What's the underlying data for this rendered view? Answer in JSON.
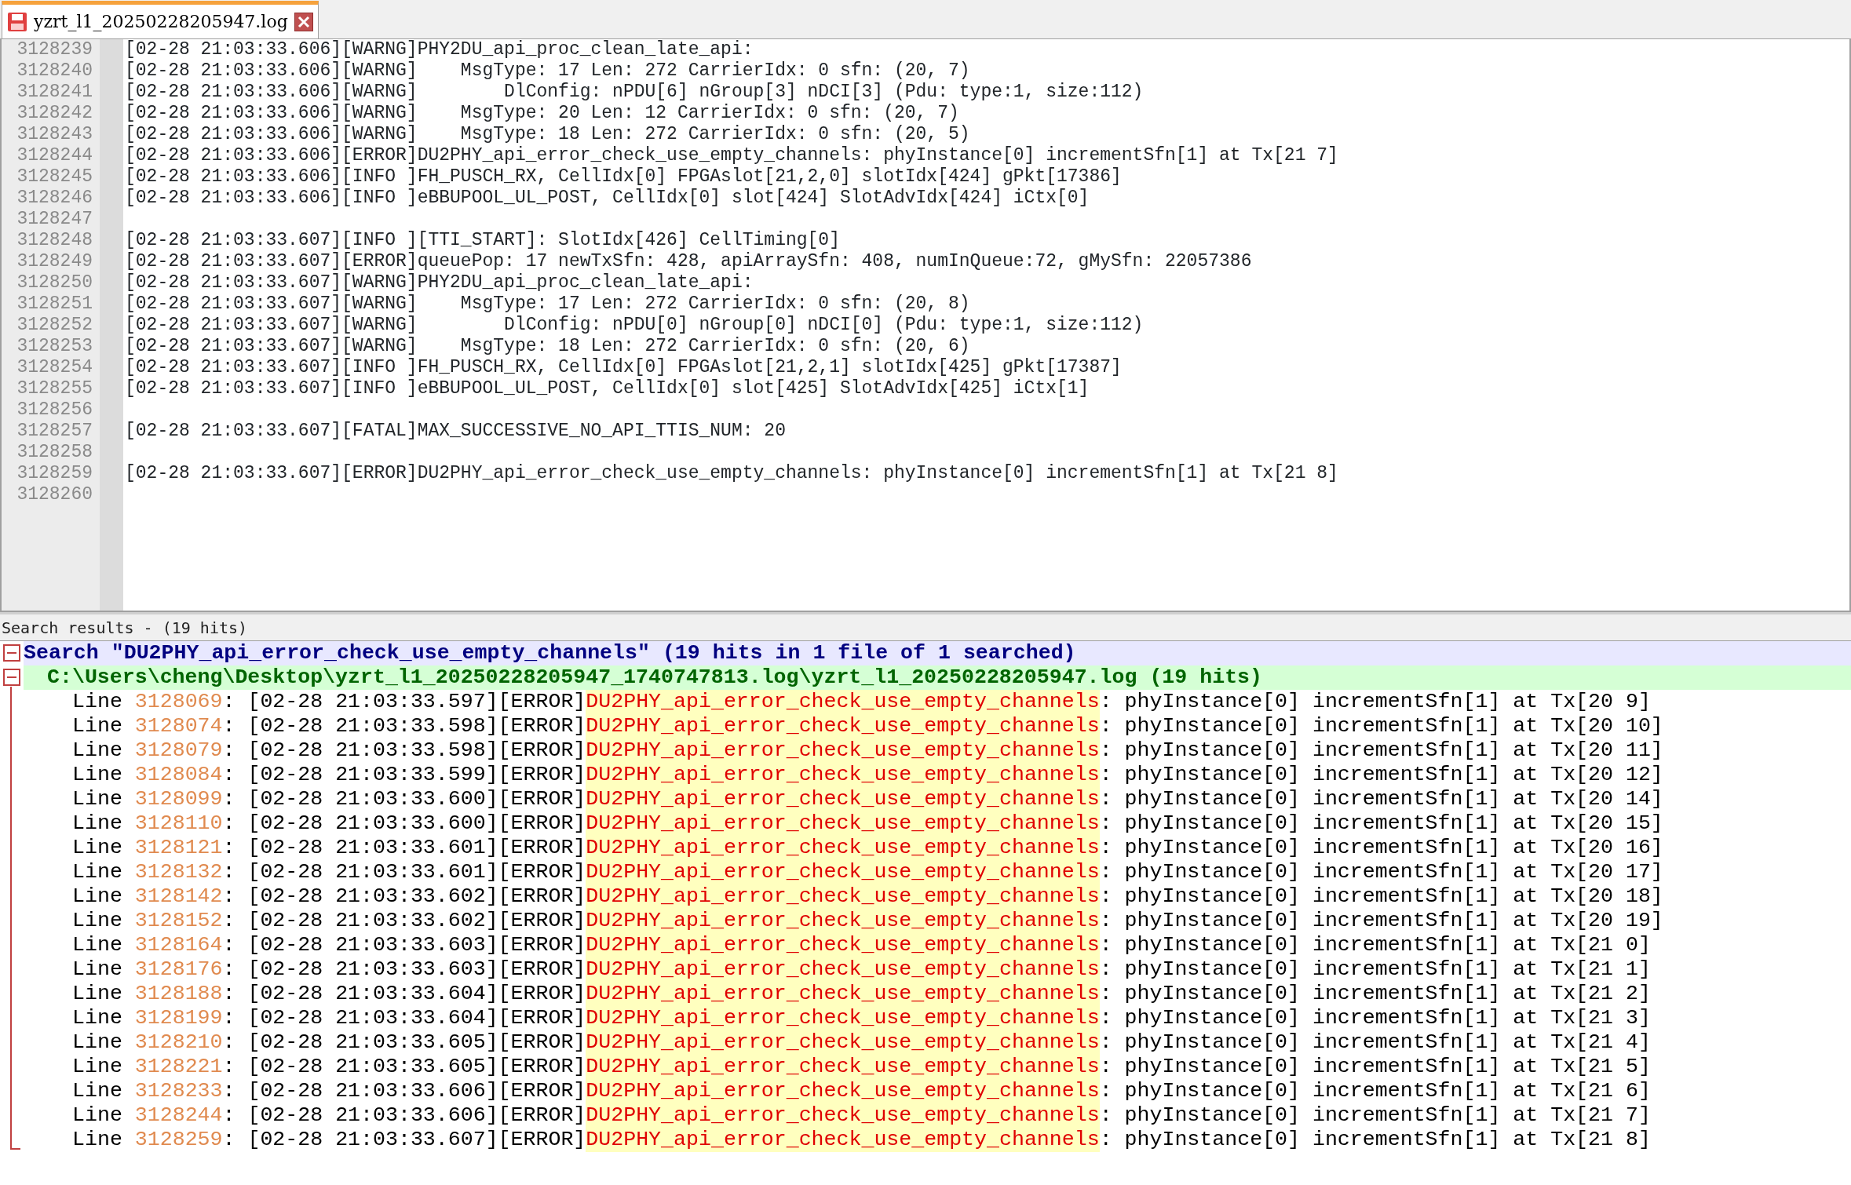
{
  "tab": {
    "title": "yzrt_l1_20250228205947.log",
    "selected": true
  },
  "editor": {
    "lines": [
      {
        "number": "3128239",
        "text": "[02-28 21:03:33.606][WARNG]PHY2DU_api_proc_clean_late_api:"
      },
      {
        "number": "3128240",
        "text": "[02-28 21:03:33.606][WARNG]    MsgType: 17 Len: 272 CarrierIdx: 0 sfn: (20, 7)"
      },
      {
        "number": "3128241",
        "text": "[02-28 21:03:33.606][WARNG]        DlConfig: nPDU[6] nGroup[3] nDCI[3] (Pdu: type:1, size:112)"
      },
      {
        "number": "3128242",
        "text": "[02-28 21:03:33.606][WARNG]    MsgType: 20 Len: 12 CarrierIdx: 0 sfn: (20, 7)"
      },
      {
        "number": "3128243",
        "text": "[02-28 21:03:33.606][WARNG]    MsgType: 18 Len: 272 CarrierIdx: 0 sfn: (20, 5)"
      },
      {
        "number": "3128244",
        "text": "[02-28 21:03:33.606][ERROR]DU2PHY_api_error_check_use_empty_channels: phyInstance[0] incrementSfn[1] at Tx[21 7]"
      },
      {
        "number": "3128245",
        "text": "[02-28 21:03:33.606][INFO ]FH_PUSCH_RX, CellIdx[0] FPGAslot[21,2,0] slotIdx[424] gPkt[17386]"
      },
      {
        "number": "3128246",
        "text": "[02-28 21:03:33.606][INFO ]eBBUPOOL_UL_POST, CellIdx[0] slot[424] SlotAdvIdx[424] iCtx[0]"
      },
      {
        "number": "3128247"
      },
      {
        "number": "3128248",
        "text": "[02-28 21:03:33.607][INFO ][TTI_START]: SlotIdx[426] CellTiming[0]"
      },
      {
        "number": "3128249",
        "text": "[02-28 21:03:33.607][ERROR]queuePop: 17 newTxSfn: 428, apiArraySfn: 408, numInQueue:72, gMySfn: 22057386"
      },
      {
        "number": "3128250",
        "text": "[02-28 21:03:33.607][WARNG]PHY2DU_api_proc_clean_late_api:"
      },
      {
        "number": "3128251",
        "text": "[02-28 21:03:33.607][WARNG]    MsgType: 17 Len: 272 CarrierIdx: 0 sfn: (20, 8)"
      },
      {
        "number": "3128252",
        "text": "[02-28 21:03:33.607][WARNG]        DlConfig: nPDU[0] nGroup[0] nDCI[0] (Pdu: type:1, size:112)"
      },
      {
        "number": "3128253",
        "text": "[02-28 21:03:33.607][WARNG]    MsgType: 18 Len: 272 CarrierIdx: 0 sfn: (20, 6)"
      },
      {
        "number": "3128254",
        "text": "[02-28 21:03:33.607][INFO ]FH_PUSCH_RX, CellIdx[0] FPGAslot[21,2,1] slotIdx[425] gPkt[17387]"
      },
      {
        "number": "3128255",
        "text": "[02-28 21:03:33.607][INFO ]eBBUPOOL_UL_POST, CellIdx[0] slot[425] SlotAdvIdx[425] iCtx[1]"
      },
      {
        "number": "3128256"
      },
      {
        "number": "3128257",
        "text": "[02-28 21:03:33.607][FATAL]MAX_SUCCESSIVE_NO_API_TTIS_NUM: 20"
      },
      {
        "number": "3128258"
      },
      {
        "number": "3128259",
        "text": "[02-28 21:03:33.607][ERROR]DU2PHY_api_error_check_use_empty_channels: phyInstance[0] incrementSfn[1] at Tx[21 8]"
      },
      {
        "number": "3128260"
      }
    ]
  },
  "search_panel": {
    "title": "Search results - (19 hits)",
    "query": {
      "text": "Search \"DU2PHY_api_error_check_use_empty_channels\" (19 hits in 1 file of 1 searched)",
      "expanded": true
    },
    "file": {
      "text": "C:\\Users\\cheng\\Desktop\\yzrt_l1_20250228205947_1740747813.log\\yzrt_l1_20250228205947.log (19 hits)",
      "expanded": true
    },
    "hits": [
      {
        "label": "Line",
        "line": "3128069",
        "before": ": [02-28 21:03:33.597][ERROR]",
        "match": "DU2PHY_api_error_check_use_empty_channels",
        "after": ": phyInstance[0] incrementSfn[1] at Tx[20 9]"
      },
      {
        "label": "Line",
        "line": "3128074",
        "before": ": [02-28 21:03:33.598][ERROR]",
        "match": "DU2PHY_api_error_check_use_empty_channels",
        "after": ": phyInstance[0] incrementSfn[1] at Tx[20 10]"
      },
      {
        "label": "Line",
        "line": "3128079",
        "before": ": [02-28 21:03:33.598][ERROR]",
        "match": "DU2PHY_api_error_check_use_empty_channels",
        "after": ": phyInstance[0] incrementSfn[1] at Tx[20 11]"
      },
      {
        "label": "Line",
        "line": "3128084",
        "before": ": [02-28 21:03:33.599][ERROR]",
        "match": "DU2PHY_api_error_check_use_empty_channels",
        "after": ": phyInstance[0] incrementSfn[1] at Tx[20 12]"
      },
      {
        "label": "Line",
        "line": "3128099",
        "before": ": [02-28 21:03:33.600][ERROR]",
        "match": "DU2PHY_api_error_check_use_empty_channels",
        "after": ": phyInstance[0] incrementSfn[1] at Tx[20 14]"
      },
      {
        "label": "Line",
        "line": "3128110",
        "before": ": [02-28 21:03:33.600][ERROR]",
        "match": "DU2PHY_api_error_check_use_empty_channels",
        "after": ": phyInstance[0] incrementSfn[1] at Tx[20 15]"
      },
      {
        "label": "Line",
        "line": "3128121",
        "before": ": [02-28 21:03:33.601][ERROR]",
        "match": "DU2PHY_api_error_check_use_empty_channels",
        "after": ": phyInstance[0] incrementSfn[1] at Tx[20 16]"
      },
      {
        "label": "Line",
        "line": "3128132",
        "before": ": [02-28 21:03:33.601][ERROR]",
        "match": "DU2PHY_api_error_check_use_empty_channels",
        "after": ": phyInstance[0] incrementSfn[1] at Tx[20 17]"
      },
      {
        "label": "Line",
        "line": "3128142",
        "before": ": [02-28 21:03:33.602][ERROR]",
        "match": "DU2PHY_api_error_check_use_empty_channels",
        "after": ": phyInstance[0] incrementSfn[1] at Tx[20 18]"
      },
      {
        "label": "Line",
        "line": "3128152",
        "before": ": [02-28 21:03:33.602][ERROR]",
        "match": "DU2PHY_api_error_check_use_empty_channels",
        "after": ": phyInstance[0] incrementSfn[1] at Tx[20 19]"
      },
      {
        "label": "Line",
        "line": "3128164",
        "before": ": [02-28 21:03:33.603][ERROR]",
        "match": "DU2PHY_api_error_check_use_empty_channels",
        "after": ": phyInstance[0] incrementSfn[1] at Tx[21 0]"
      },
      {
        "label": "Line",
        "line": "3128176",
        "before": ": [02-28 21:03:33.603][ERROR]",
        "match": "DU2PHY_api_error_check_use_empty_channels",
        "after": ": phyInstance[0] incrementSfn[1] at Tx[21 1]"
      },
      {
        "label": "Line",
        "line": "3128188",
        "before": ": [02-28 21:03:33.604][ERROR]",
        "match": "DU2PHY_api_error_check_use_empty_channels",
        "after": ": phyInstance[0] incrementSfn[1] at Tx[21 2]"
      },
      {
        "label": "Line",
        "line": "3128199",
        "before": ": [02-28 21:03:33.604][ERROR]",
        "match": "DU2PHY_api_error_check_use_empty_channels",
        "after": ": phyInstance[0] incrementSfn[1] at Tx[21 3]"
      },
      {
        "label": "Line",
        "line": "3128210",
        "before": ": [02-28 21:03:33.605][ERROR]",
        "match": "DU2PHY_api_error_check_use_empty_channels",
        "after": ": phyInstance[0] incrementSfn[1] at Tx[21 4]"
      },
      {
        "label": "Line",
        "line": "3128221",
        "before": ": [02-28 21:03:33.605][ERROR]",
        "match": "DU2PHY_api_error_check_use_empty_channels",
        "after": ": phyInstance[0] incrementSfn[1] at Tx[21 5]"
      },
      {
        "label": "Line",
        "line": "3128233",
        "before": ": [02-28 21:03:33.606][ERROR]",
        "match": "DU2PHY_api_error_check_use_empty_channels",
        "after": ": phyInstance[0] incrementSfn[1] at Tx[21 6]"
      },
      {
        "label": "Line",
        "line": "3128244",
        "before": ": [02-28 21:03:33.606][ERROR]",
        "match": "DU2PHY_api_error_check_use_empty_channels",
        "after": ": phyInstance[0] incrementSfn[1] at Tx[21 7]"
      },
      {
        "label": "Line",
        "line": "3128259",
        "before": ": [02-28 21:03:33.607][ERROR]",
        "match": "DU2PHY_api_error_check_use_empty_channels",
        "after": ": phyInstance[0] incrementSfn[1] at Tx[21 8]"
      }
    ]
  }
}
